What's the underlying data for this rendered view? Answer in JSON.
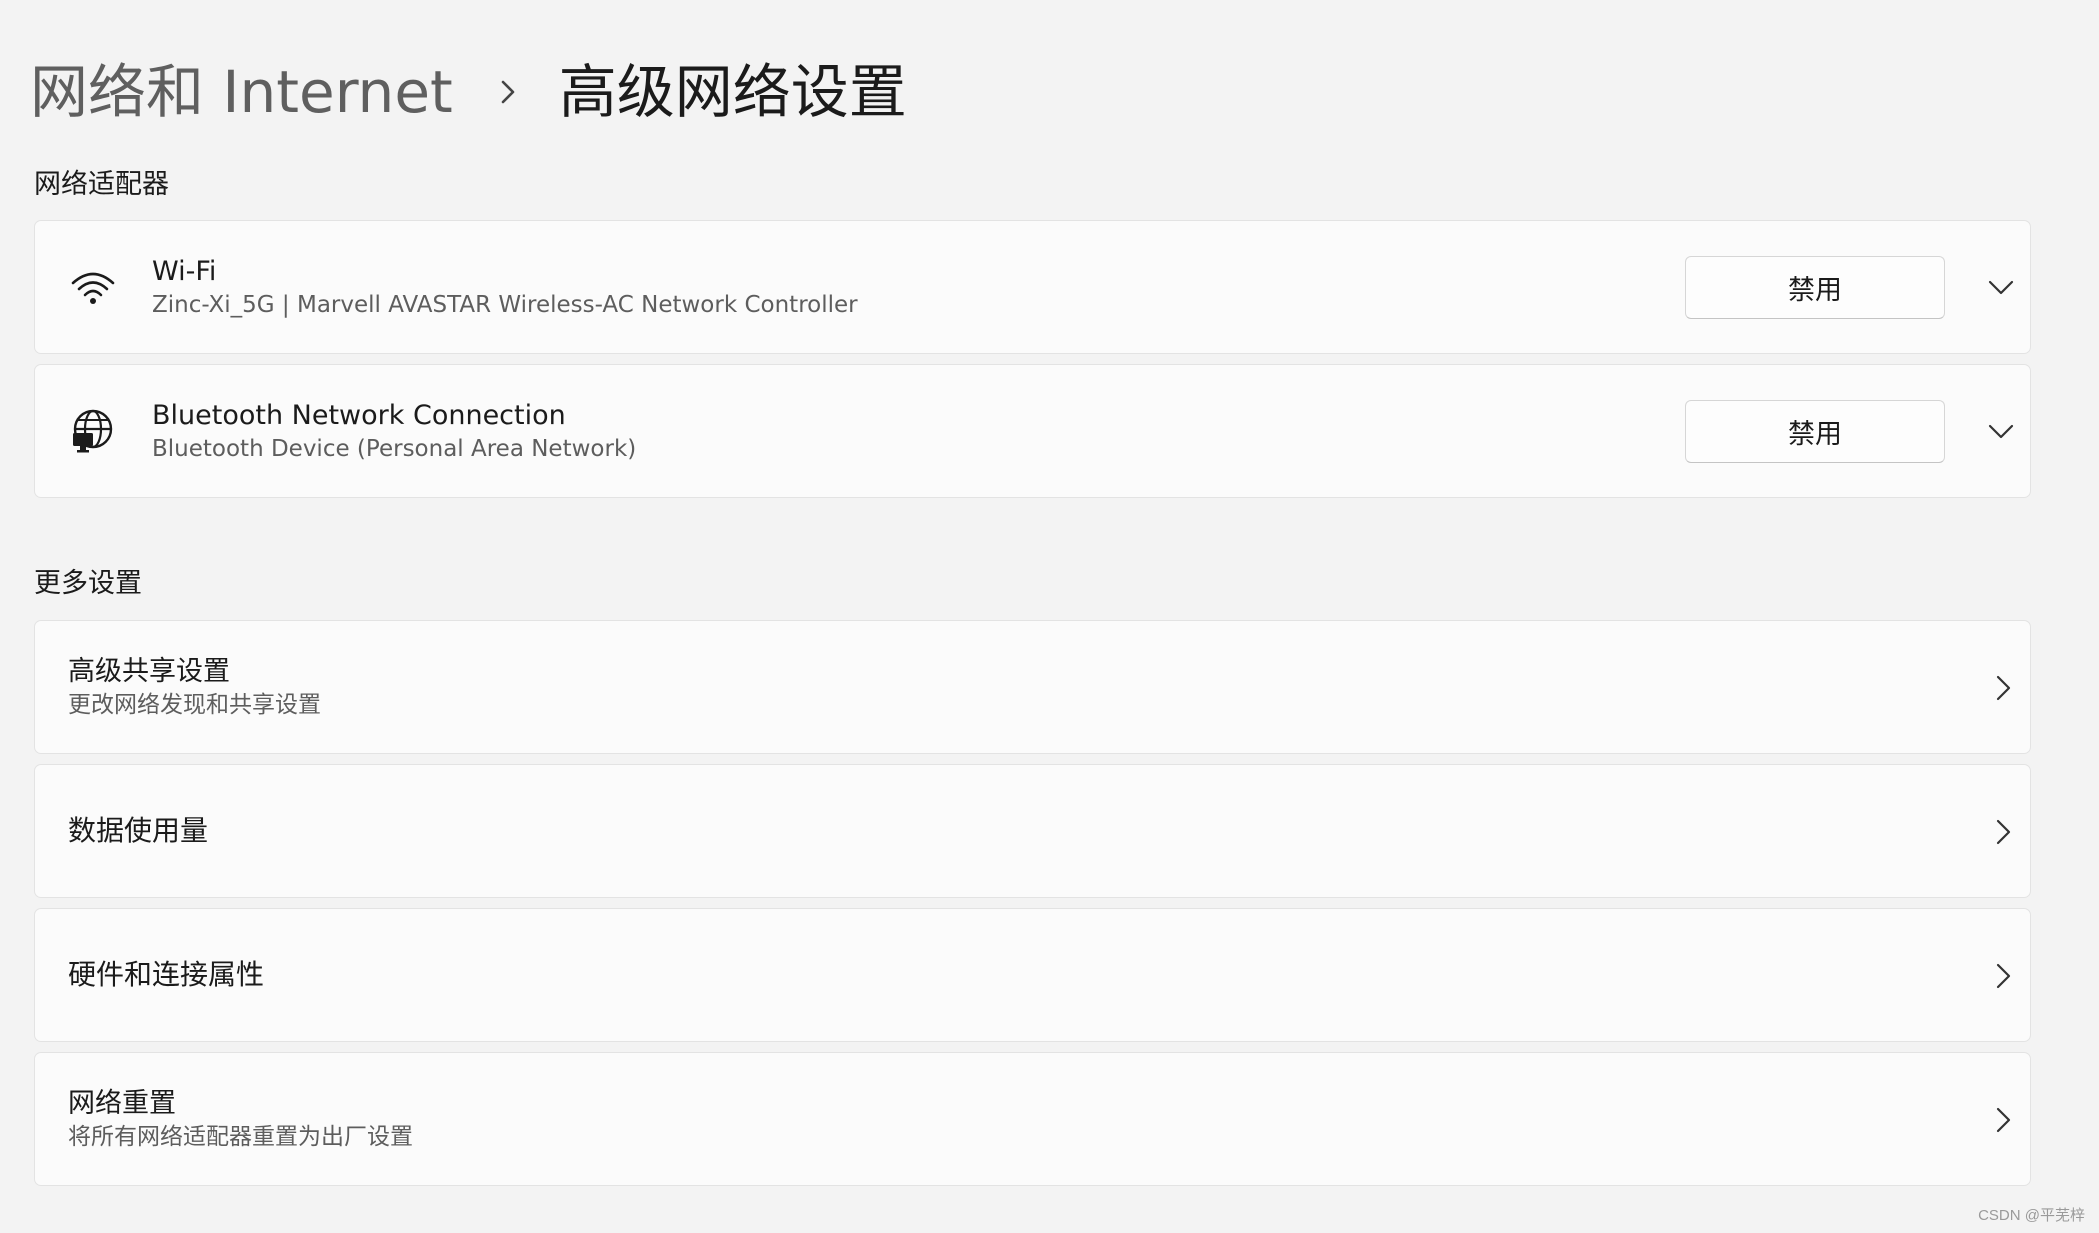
{
  "breadcrumb": {
    "parent": "网络和 Internet",
    "current": "高级网络设置"
  },
  "network_adapters": {
    "section_title": "网络适配器",
    "items": [
      {
        "icon": "wifi-icon",
        "title": "Wi-Fi",
        "subtitle": "Zinc-Xi_5G | Marvell AVASTAR Wireless-AC Network Controller",
        "button_label": "禁用"
      },
      {
        "icon": "ethernet-globe-icon",
        "title": "Bluetooth Network Connection",
        "subtitle": "Bluetooth Device (Personal Area Network)",
        "button_label": "禁用"
      }
    ]
  },
  "more_settings": {
    "section_title": "更多设置",
    "items": [
      {
        "title": "高级共享设置",
        "subtitle": "更改网络发现和共享设置"
      },
      {
        "title": "数据使用量"
      },
      {
        "title": "硬件和连接属性"
      },
      {
        "title": "网络重置",
        "subtitle": "将所有网络适配器重置为出厂设置"
      }
    ]
  },
  "watermark": "CSDN @平芜梓",
  "colors": {
    "background": "#f3f3f3",
    "card": "#fbfbfb",
    "card_border": "#e3e3e3"
  }
}
